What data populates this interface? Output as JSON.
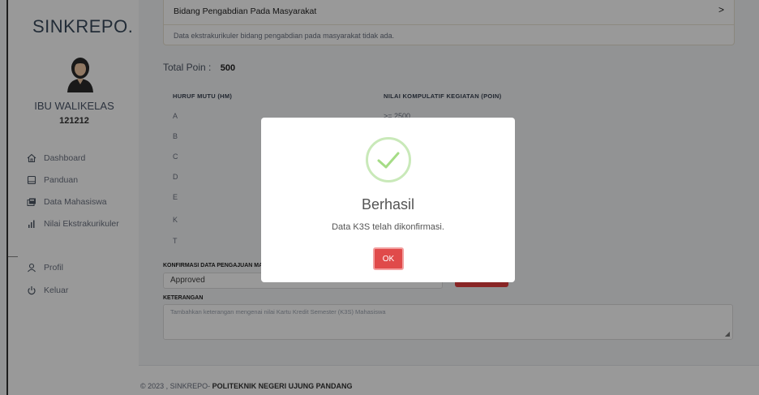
{
  "sidebar": {
    "brand": "SINKREPO.",
    "user_name": "IBU WALIKELAS",
    "user_id": "121212",
    "items": [
      {
        "label": "Dashboard",
        "icon": "home-icon"
      },
      {
        "label": "Panduan",
        "icon": "book-icon"
      },
      {
        "label": "Data Mahasiswa",
        "icon": "users-card-icon"
      },
      {
        "label": "Nilai Ekstrakurikuler",
        "icon": "bar-chart-icon"
      },
      {
        "label": "Profil",
        "icon": "user-icon"
      },
      {
        "label": "Keluar",
        "icon": "power-icon"
      }
    ]
  },
  "section": {
    "heading": "Bidang Pengabdian Pada Masyarakat",
    "chevron": ">",
    "empty_message": "Data ekstrakurikuler bidang pengabdian pada masyarakat tidak ada."
  },
  "total": {
    "label": "Total Poin :",
    "value": "500"
  },
  "grade_table": {
    "col_grade": "HURUF MUTU (HM)",
    "col_points": "NILAI KOMPULATIF KEGIATAN (POIN)",
    "rows": [
      {
        "grade": "A",
        "points": ">= 2500"
      },
      {
        "grade": "B"
      },
      {
        "grade": "C"
      },
      {
        "grade": "D"
      },
      {
        "grade": "E"
      },
      {
        "grade": "K"
      },
      {
        "grade": "T"
      }
    ]
  },
  "form": {
    "confirm_label": "KONFIRMASI DATA PENGAJUAN MA",
    "confirm_value": "Approved",
    "note_label": "KETERANGAN",
    "note_placeholder": "Tambahkan keterangan mengenai nilai Kartu Kredit Semester (K3S) Mahasiswa"
  },
  "footer": {
    "prefix": "© 2023 , SINKREPO- ",
    "org": "POLITEKNIK NEGERI UJUNG PANDANG"
  },
  "modal": {
    "title": "Berhasil",
    "message": "Data K3S telah dikonfirmasi.",
    "ok_label": "OK"
  },
  "colors": {
    "success": "#a5dc86",
    "danger": "#e53e3e"
  }
}
